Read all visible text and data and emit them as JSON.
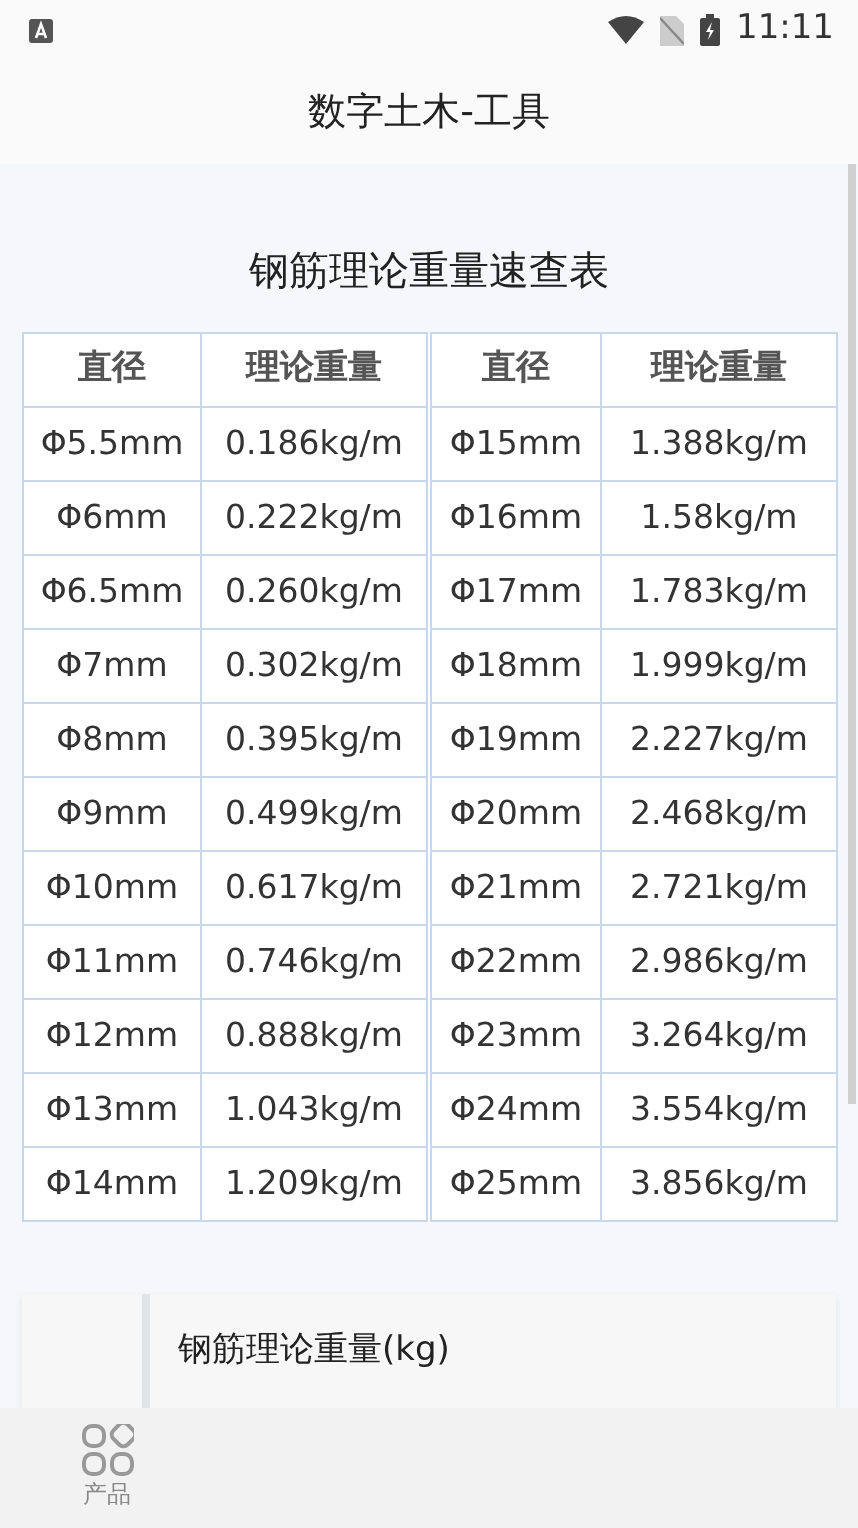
{
  "status_bar": {
    "time": "11:11"
  },
  "header": {
    "title": "数字土木-工具"
  },
  "table": {
    "title": "钢筋理论重量速查表",
    "columns": [
      "直径",
      "理论重量",
      "直径",
      "理论重量"
    ],
    "rows": [
      [
        "Φ5.5mm",
        "0.186kg/m",
        "Φ15mm",
        "1.388kg/m"
      ],
      [
        "Φ6mm",
        "0.222kg/m",
        "Φ16mm",
        "1.58kg/m"
      ],
      [
        "Φ6.5mm",
        "0.260kg/m",
        "Φ17mm",
        "1.783kg/m"
      ],
      [
        "Φ7mm",
        "0.302kg/m",
        "Φ18mm",
        "1.999kg/m"
      ],
      [
        "Φ8mm",
        "0.395kg/m",
        "Φ19mm",
        "2.227kg/m"
      ],
      [
        "Φ9mm",
        "0.499kg/m",
        "Φ20mm",
        "2.468kg/m"
      ],
      [
        "Φ10mm",
        "0.617kg/m",
        "Φ21mm",
        "2.721kg/m"
      ],
      [
        "Φ11mm",
        "0.746kg/m",
        "Φ22mm",
        "2.986kg/m"
      ],
      [
        "Φ12mm",
        "0.888kg/m",
        "Φ23mm",
        "3.264kg/m"
      ],
      [
        "Φ13mm",
        "1.043kg/m",
        "Φ24mm",
        "3.554kg/m"
      ],
      [
        "Φ14mm",
        "1.209kg/m",
        "Φ25mm",
        "3.856kg/m"
      ]
    ]
  },
  "result_card": {
    "label": "钢筋理论重量(kg)"
  },
  "nav": [
    {
      "label": "产品",
      "selected": false
    }
  ]
}
